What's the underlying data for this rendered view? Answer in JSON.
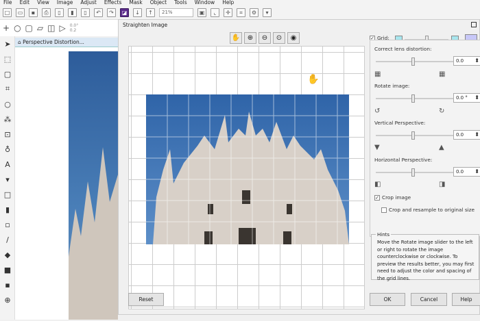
{
  "menu": [
    "File",
    "Edit",
    "View",
    "Image",
    "Adjust",
    "Effects",
    "Mask",
    "Object",
    "Tools",
    "Window",
    "Help"
  ],
  "toolbar": {
    "zoom": "21%"
  },
  "propbar": {
    "value_top": "0.0°",
    "value_bottom": "0.2"
  },
  "popup": {
    "label": "Perspective Distortion..."
  },
  "dialog": {
    "title": "Straighten Image",
    "grid_label": "Grid:",
    "grid_checked": true,
    "lens_label": "Correct lens distortion:",
    "lens_value": "0.0",
    "rotate_label": "Rotate image:",
    "rotate_value": "0.0 °",
    "vertical_label": "Vertical Perspective:",
    "vertical_value": "0.0",
    "horizontal_label": "Horizontal Perspective:",
    "horizontal_value": "0.0",
    "crop_label": "Crop image",
    "crop_checked": true,
    "resample_label": "Crop and resample to original size",
    "resample_checked": false,
    "hints_title": "Hints",
    "hints_text": "Move the Rotate image slider to the left or right to rotate the image counterclockwise or clockwise. To preview the results better, you may first need to adjust the color and spacing of the grid lines.",
    "reset": "Reset",
    "ok": "OK",
    "cancel": "Cancel",
    "help": "Help",
    "grid_color": "#a8e6ee",
    "grid_color2": "#c8c8f8"
  }
}
